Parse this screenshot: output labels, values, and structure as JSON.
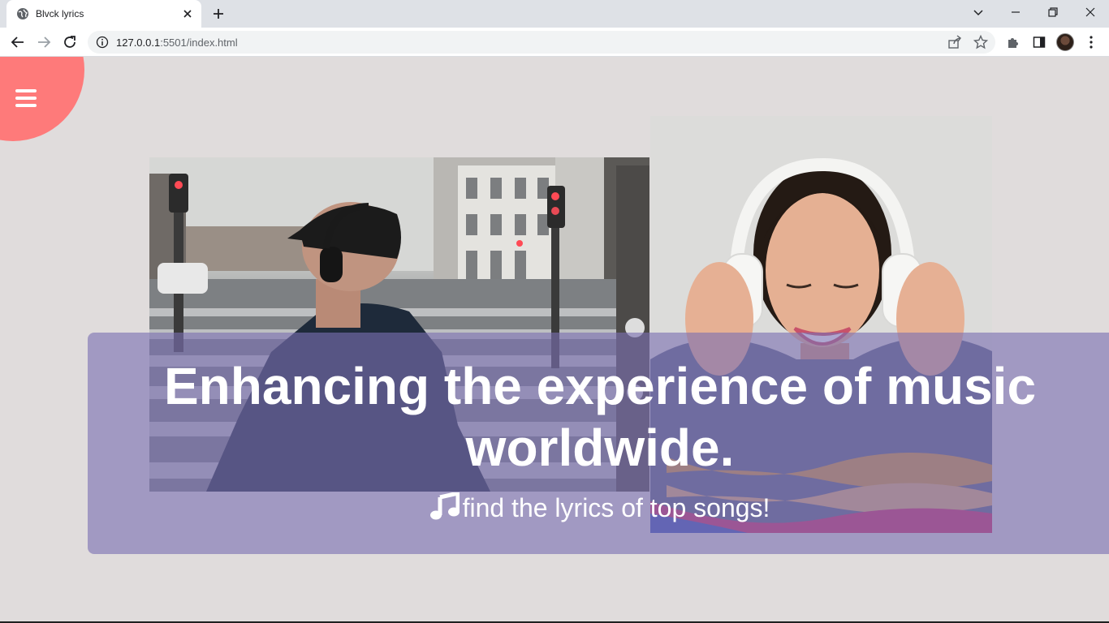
{
  "browser": {
    "tab_title": "Blvck lyrics",
    "url_host": "127.0.0.1",
    "url_rest": ":5501/index.html"
  },
  "hero": {
    "headline_line1": "Enhancing the experience of music",
    "headline_line2": "worldwide.",
    "tagline": "find the lyrics of top songs!",
    "tagline_icon": "music-note-icon"
  },
  "colors": {
    "menu_blob": "#fe7a7a",
    "overlay": "#7a70b2",
    "page_background": "#e0dcdc"
  }
}
